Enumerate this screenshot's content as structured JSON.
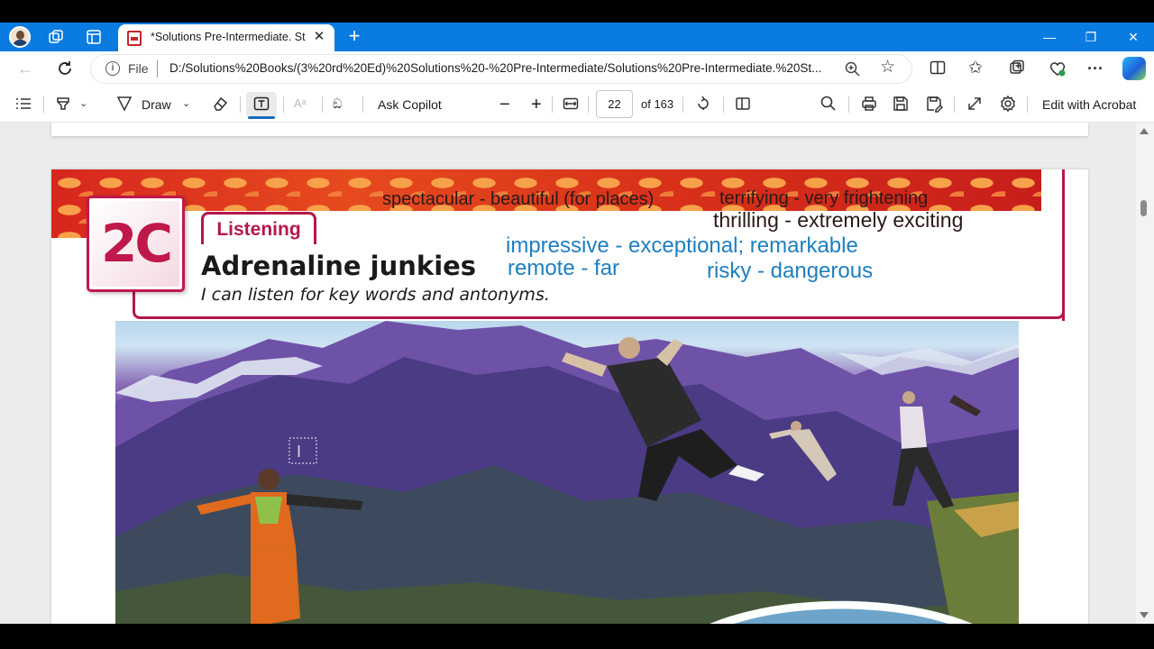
{
  "browser": {
    "tab_title": "*Solutions Pre-Intermediate. Stuc",
    "tab_close": "✕",
    "new_tab": "+",
    "window_controls": {
      "minimize": "—",
      "restore": "❐",
      "close": "✕"
    },
    "address": {
      "scheme_label": "File",
      "url": "D:/Solutions%20Books/(3%20rd%20Ed)%20Solutions%20-%20Pre-Intermediate/Solutions%20Pre-Intermediate.%20St..."
    },
    "more": "···"
  },
  "pdf_toolbar": {
    "draw_label": "Draw",
    "ask_copilot": "Ask Copilot",
    "zoom_out": "−",
    "zoom_in": "+",
    "page_current": "22",
    "page_total": "of 163",
    "edit_acrobat": "Edit with Acrobat"
  },
  "document": {
    "badge": "2C",
    "section": "Listening",
    "title": "Adrenaline junkies",
    "subtitle": "I can listen for key words and antonyms.",
    "annotations_dark": [
      "spectacular - beautiful (for places)",
      "terrifying - very frightening",
      "thrilling - extremely exciting"
    ],
    "annotations_blue": [
      "impressive - exceptional; remarkable",
      "remote - far",
      "risky - dangerous"
    ]
  },
  "colors": {
    "titlebar": "#0a7be0",
    "accent_magenta": "#b4174c",
    "annotation_blue": "#1d7fbf"
  }
}
